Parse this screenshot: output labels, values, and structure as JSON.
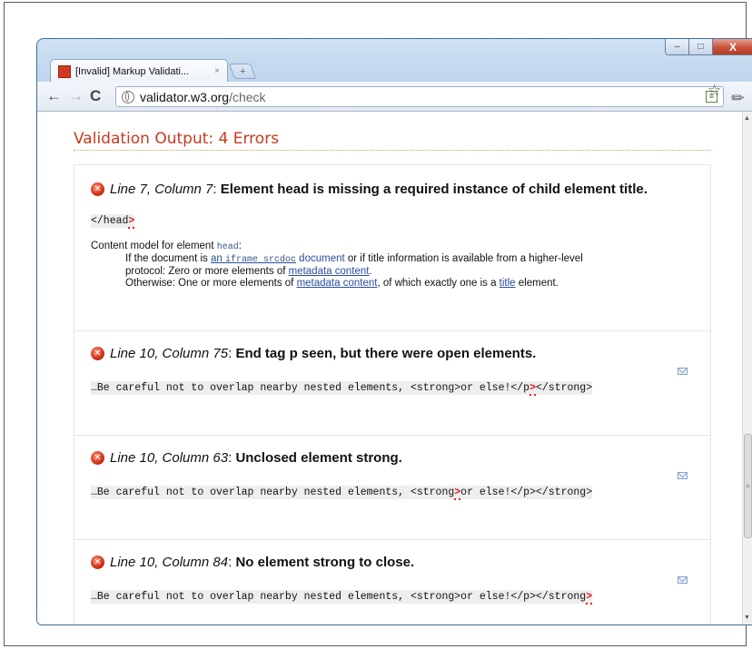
{
  "browser": {
    "tab_title": "[Invalid] Markup Validati...",
    "tab_close": "×",
    "new_tab": "+",
    "url_host": "validator.w3.org",
    "url_path": "/check",
    "win_min": "–",
    "win_max": "□",
    "win_close": "X",
    "back": "←",
    "forward": "→",
    "reload": "C",
    "star": "☆",
    "wrench": "🔧"
  },
  "page": {
    "title": "Validation Output: 4 Errors"
  },
  "errors": [
    {
      "location": "Line 7, Column 7",
      "message": "Element head is missing a required instance of child element title.",
      "code_before": "</head",
      "code_mark": ">",
      "code_after": "",
      "content_model": {
        "intro": "Content model for element ",
        "element": "head",
        "intro_end": ":",
        "line1_a": "If the document is ",
        "line1_link1": "an ",
        "line1_link1_mono": "iframe srcdoc",
        "line1_link1_b": " document",
        "line1_b": " or if title information is available from a higher-level",
        "line2_a": "protocol: Zero or more elements of ",
        "line2_link": "metadata content",
        "line2_b": ".",
        "line3_a": "Otherwise: One or more elements of ",
        "line3_link": "metadata content",
        "line3_b": ", of which exactly one is a ",
        "line3_link2": "title",
        "line3_c": " element."
      }
    },
    {
      "location": "Line 10, Column 75",
      "message": "End tag p seen, but there were open elements.",
      "code_before": "…Be careful not to overlap nearby nested elements, <strong>or else!</p",
      "code_mark": ">",
      "code_after": "</strong>"
    },
    {
      "location": "Line 10, Column 63",
      "message": "Unclosed element strong.",
      "code_before": "…Be careful not to overlap nearby nested elements, <strong",
      "code_mark": ">",
      "code_after": "or else!</p></strong>"
    },
    {
      "location": "Line 10, Column 84",
      "message": "No element strong to close.",
      "code_before": "…Be careful not to overlap nearby nested elements, <strong>or else!</p></strong",
      "code_mark": ">",
      "code_after": ""
    }
  ],
  "colors": {
    "title": "#c8391e",
    "error_icon": "#cc2a12",
    "link": "#2a4d9c"
  }
}
